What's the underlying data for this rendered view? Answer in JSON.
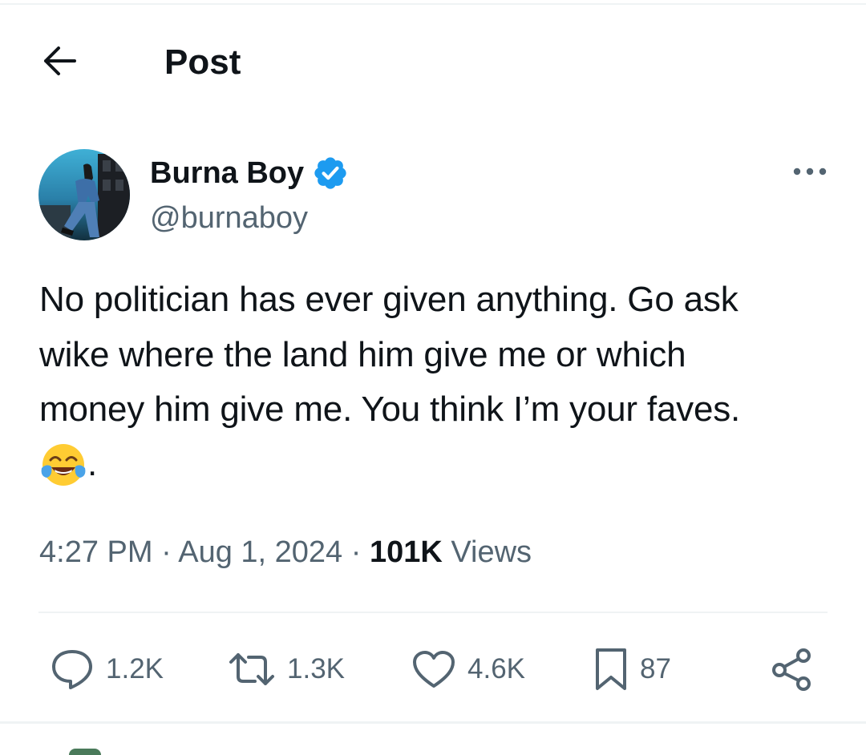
{
  "header": {
    "title": "Post",
    "back_icon": "arrow-left-icon"
  },
  "author": {
    "name": "Burna Boy",
    "handle": "@burnaboy",
    "verified_icon": "verified-badge-icon",
    "verified_color": "#1d9bf0"
  },
  "tweet": {
    "lines": [
      "No politician has ever given anything. Go ask",
      "wike where the land him give me or which",
      "money him give me. You think I’m your faves."
    ],
    "emoji": "face-with-tears-of-joy",
    "trailing": "."
  },
  "meta": {
    "time": "4:27 PM",
    "separator": "·",
    "date": "Aug 1, 2024",
    "views_count": "101K",
    "views_label": "Views"
  },
  "actions": {
    "reply": {
      "icon": "reply-icon",
      "count": "1.2K"
    },
    "repost": {
      "icon": "repost-icon",
      "count": "1.3K"
    },
    "like": {
      "icon": "heart-icon",
      "count": "4.6K"
    },
    "bookmark": {
      "icon": "bookmark-icon",
      "count": "87"
    },
    "share": {
      "icon": "share-icon"
    }
  },
  "colors": {
    "text": "#0f1419",
    "secondary": "#536471",
    "divider": "#eff3f4",
    "accent": "#1d9bf0"
  }
}
